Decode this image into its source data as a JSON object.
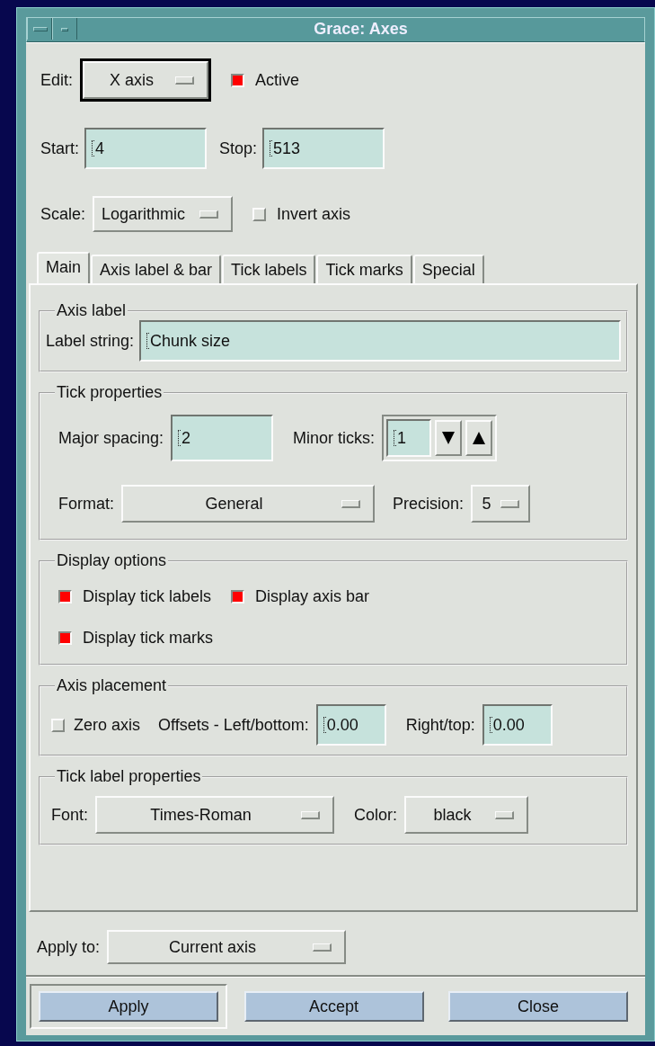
{
  "window": {
    "title": "Grace: Axes"
  },
  "edit": {
    "label": "Edit:",
    "value": "X axis"
  },
  "active": {
    "label": "Active",
    "checked": true
  },
  "start": {
    "label": "Start:",
    "value": "4"
  },
  "stop": {
    "label": "Stop:",
    "value": "513"
  },
  "scale": {
    "label": "Scale:",
    "value": "Logarithmic"
  },
  "invert_axis": {
    "label": "Invert axis",
    "checked": false
  },
  "tabs": [
    {
      "label": "Main",
      "selected": true
    },
    {
      "label": "Axis label & bar",
      "selected": false
    },
    {
      "label": "Tick labels",
      "selected": false
    },
    {
      "label": "Tick marks",
      "selected": false
    },
    {
      "label": "Special",
      "selected": false
    }
  ],
  "sections": [
    {
      "title": "Axis label",
      "rows": [
        [
          {
            "kind": "field",
            "label": "Label string:",
            "value": "Chunk size"
          }
        ]
      ]
    },
    {
      "title": "Tick properties",
      "rows": [
        [
          {
            "kind": "field",
            "label": "Major spacing:",
            "value": "2"
          },
          {
            "kind": "spin",
            "label": "Minor ticks:",
            "value": "1"
          }
        ],
        [
          {
            "kind": "menu",
            "label": "Format:",
            "value": "General"
          },
          {
            "kind": "menu",
            "label": "Precision:",
            "value": "5"
          }
        ]
      ]
    },
    {
      "title": "Display options",
      "rows": [
        [
          {
            "kind": "check",
            "label": "Display tick labels",
            "checked": true
          },
          {
            "kind": "check",
            "label": "Display axis bar",
            "checked": true
          }
        ],
        [
          {
            "kind": "check",
            "label": "Display tick marks",
            "checked": true
          }
        ]
      ]
    },
    {
      "title": "Axis placement",
      "rows": [
        [
          {
            "kind": "check",
            "label": "Zero axis",
            "checked": false
          },
          {
            "kind": "field",
            "label": "Offsets - Left/bottom:",
            "value": "0.00"
          },
          {
            "kind": "field",
            "label": "Right/top:",
            "value": "0.00"
          }
        ]
      ]
    },
    {
      "title": "Tick label properties",
      "rows": [
        [
          {
            "kind": "menu",
            "label": "Font:",
            "value": "Times-Roman"
          },
          {
            "kind": "menu",
            "label": "Color:",
            "value": "black"
          }
        ]
      ]
    }
  ],
  "apply_to": {
    "label": "Apply to:",
    "value": "Current axis"
  },
  "buttons": [
    {
      "label": "Apply",
      "default": true
    },
    {
      "label": "Accept",
      "default": false
    },
    {
      "label": "Close",
      "default": false
    }
  ]
}
